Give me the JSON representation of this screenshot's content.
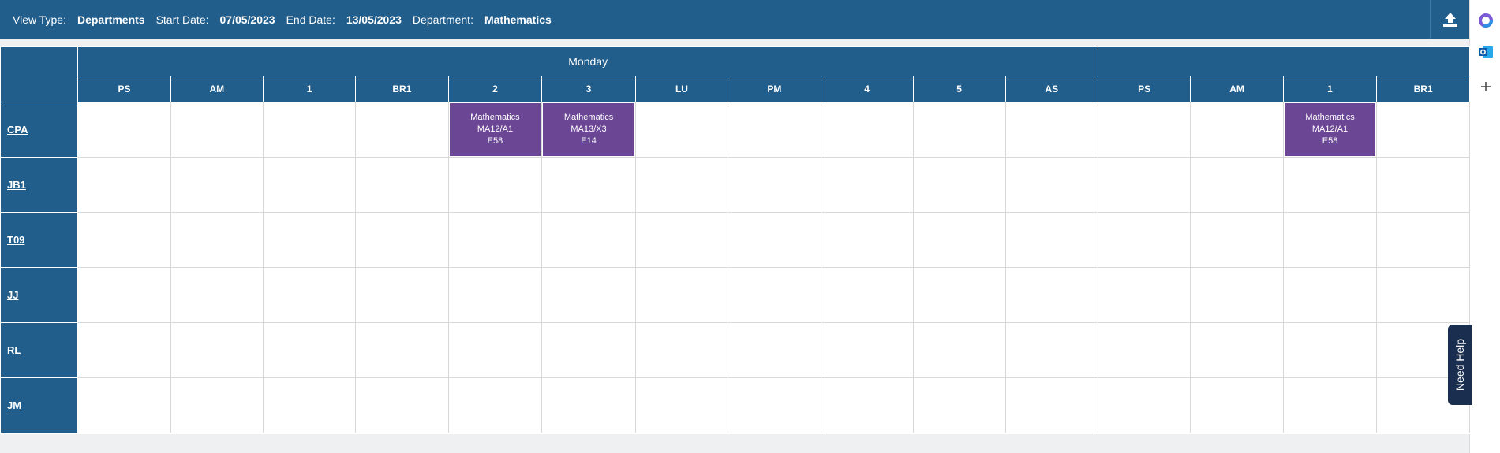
{
  "toolbar": {
    "view_type_label": "View Type:",
    "view_type_value": "Departments",
    "start_label": "Start Date:",
    "start_value": "07/05/2023",
    "end_label": "End Date:",
    "end_value": "13/05/2023",
    "dept_label": "Department:",
    "dept_value": "Mathematics",
    "upload_icon": "upload-icon"
  },
  "days": [
    {
      "name": "Monday"
    },
    {
      "name": ""
    }
  ],
  "periods": [
    "PS",
    "AM",
    "1",
    "BR1",
    "2",
    "3",
    "LU",
    "PM",
    "4",
    "5",
    "AS",
    "PS",
    "AM",
    "1",
    "BR1"
  ],
  "rows": [
    {
      "label": "CPA",
      "lessons": [
        {
          "col": 4,
          "subject": "Mathematics",
          "class": "MA12/A1",
          "room": "E58"
        },
        {
          "col": 5,
          "subject": "Mathematics",
          "class": "MA13/X3",
          "room": "E14"
        },
        {
          "col": 13,
          "subject": "Mathematics",
          "class": "MA12/A1",
          "room": "E58"
        }
      ]
    },
    {
      "label": "JB1",
      "lessons": []
    },
    {
      "label": "T09",
      "lessons": []
    },
    {
      "label": "JJ",
      "lessons": []
    },
    {
      "label": "RL",
      "lessons": []
    },
    {
      "label": "JM",
      "lessons": []
    }
  ],
  "help": {
    "label": "Need Help"
  },
  "colors": {
    "header": "#215e8c",
    "lesson": "#6a4694",
    "help_tab": "#1a2e4f"
  }
}
